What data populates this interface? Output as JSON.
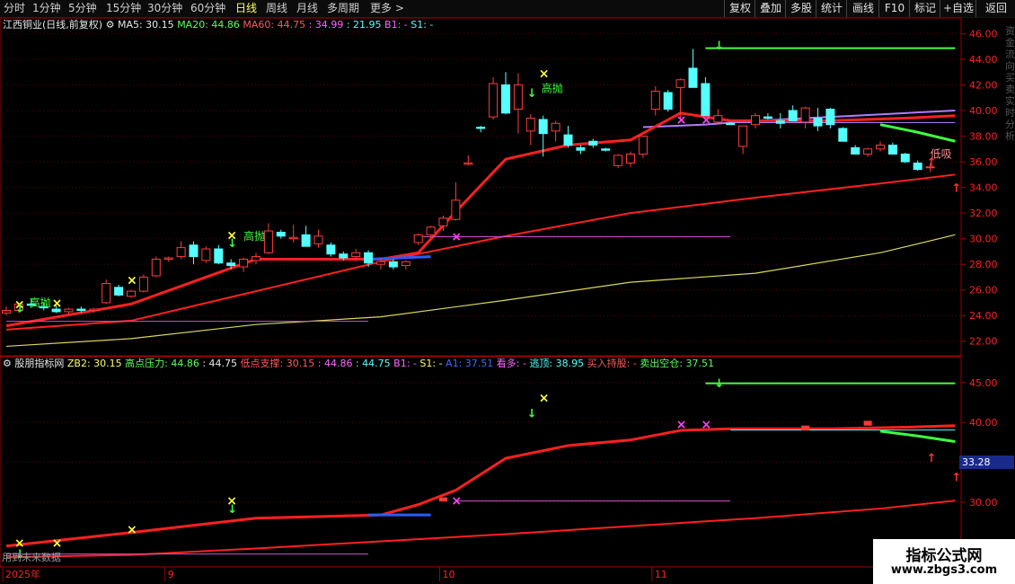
{
  "toolbar": {
    "tabs": [
      "分时",
      "1分钟",
      "5分钟",
      "15分钟",
      "30分钟",
      "60分钟",
      "日线",
      "周线",
      "月线",
      "多周期",
      "更多 >"
    ],
    "active_tab": "日线",
    "buttons": [
      "复权",
      "叠加",
      "多股",
      "统计",
      "画线",
      "F10",
      "标记",
      "+自选",
      "返回"
    ]
  },
  "main_panel": {
    "stock_title": "江西铜业(日线,前复权)",
    "ma5_label": "MA5: 30.15",
    "ma20_label": "MA20: 44.86",
    "ma60_label": "MA60: 44.75",
    "extra_1": ": 34.99",
    "extra_2": ": 21.95",
    "b1_label": "B1: -",
    "s1_label": "S1: -"
  },
  "sub_panel": {
    "indicator_name": "股朋指标网",
    "zb2": "ZB2: 30.15",
    "high_pressure": "高点压力: 44.86",
    "v1": ": 44.75",
    "low_support": "低点支撑: 30.15",
    "v2": ": 44.86",
    "v3": ": 44.75",
    "b1": "B1: -",
    "s1": "S1: -",
    "a1": "A1: 37.51",
    "look_long": "看多: -",
    "escape_top": "逃顶: 38.95",
    "buy_hold": "买入持股: -",
    "sell_empty": "卖出空仓: 37.51",
    "value_badge": "33.28",
    "future_data_note": "用到未来数据"
  },
  "annotations": {
    "high_throw": "高抛",
    "low_buy": "低吸"
  },
  "right_side_text": "资金流向 买卖 实时 分析",
  "watermark": {
    "line1": "指标公式网",
    "line2": "www.zbgs3.com"
  },
  "colors": {
    "up": "#ff3b3b",
    "down": "#54ffff",
    "ma_red": "#ff2020",
    "ma_yellow": "#d8d85a",
    "ma_purple": "#b07cff",
    "resist_green": "#40ff40",
    "support_magenta": "#d050d0",
    "blue_seg": "#2a5cff",
    "axis": "#a00000"
  },
  "chart_data": [
    {
      "type": "candlestick",
      "name": "江西铜业 daily (前复权)",
      "y_ticks": [
        22.0,
        24.0,
        26.0,
        28.0,
        30.0,
        32.0,
        34.0,
        36.0,
        38.0,
        40.0,
        42.0,
        44.0,
        46.0
      ],
      "ylim": [
        21.0,
        46.8
      ],
      "x_labels": [
        "2025年",
        "9",
        "10",
        "11"
      ],
      "x_label_index": [
        0,
        13,
        35,
        52
      ],
      "ohlc": [
        [
          24.2,
          24.7,
          24.0,
          24.4
        ],
        [
          24.4,
          25.0,
          24.2,
          24.9
        ],
        [
          24.9,
          25.3,
          24.6,
          24.8
        ],
        [
          24.7,
          25.0,
          24.4,
          24.6
        ],
        [
          24.5,
          24.8,
          24.2,
          24.3
        ],
        [
          24.3,
          24.6,
          24.1,
          24.5
        ],
        [
          24.5,
          24.7,
          24.2,
          24.4
        ],
        [
          24.4,
          24.6,
          24.2,
          24.5
        ],
        [
          25.0,
          26.8,
          24.9,
          26.5
        ],
        [
          26.2,
          26.4,
          25.5,
          25.6
        ],
        [
          25.5,
          26.0,
          25.4,
          25.9
        ],
        [
          25.9,
          27.2,
          25.8,
          27.0
        ],
        [
          27.1,
          28.6,
          27.0,
          28.4
        ],
        [
          28.4,
          28.6,
          28.2,
          28.5
        ],
        [
          28.6,
          29.8,
          28.4,
          29.3
        ],
        [
          29.5,
          29.8,
          28.0,
          28.6
        ],
        [
          28.3,
          29.4,
          28.1,
          29.2
        ],
        [
          29.2,
          29.5,
          28.0,
          28.1
        ],
        [
          28.1,
          28.4,
          27.6,
          27.9
        ],
        [
          27.8,
          28.5,
          27.4,
          28.4
        ],
        [
          28.3,
          28.9,
          28.0,
          28.6
        ],
        [
          28.9,
          31.2,
          28.8,
          30.6
        ],
        [
          30.5,
          30.7,
          30.0,
          30.2
        ],
        [
          30.0,
          31.1,
          29.7,
          30.1
        ],
        [
          30.3,
          31.0,
          29.6,
          29.4
        ],
        [
          29.6,
          30.7,
          29.3,
          30.2
        ],
        [
          29.5,
          29.7,
          28.6,
          28.8
        ],
        [
          28.8,
          29.0,
          28.3,
          28.5
        ],
        [
          28.6,
          29.2,
          28.3,
          28.9
        ],
        [
          28.9,
          29.1,
          27.8,
          28.1
        ],
        [
          28.0,
          28.5,
          27.6,
          28.2
        ],
        [
          28.2,
          28.4,
          27.6,
          27.8
        ],
        [
          27.9,
          28.3,
          27.6,
          28.2
        ],
        [
          29.7,
          30.4,
          29.5,
          30.3
        ],
        [
          30.3,
          31.0,
          30.1,
          30.9
        ],
        [
          31.0,
          31.8,
          30.6,
          31.6
        ],
        [
          31.5,
          34.4,
          31.4,
          33.0
        ],
        [
          35.8,
          36.5,
          35.7,
          35.9
        ],
        [
          38.7,
          38.8,
          38.3,
          38.6
        ],
        [
          39.5,
          42.6,
          39.3,
          42.1
        ],
        [
          42.0,
          43.0,
          39.7,
          39.8
        ],
        [
          40.1,
          42.9,
          38.2,
          42.0
        ],
        [
          38.4,
          39.7,
          37.3,
          39.4
        ],
        [
          39.3,
          39.6,
          36.4,
          38.2
        ],
        [
          38.4,
          39.2,
          37.6,
          39.0
        ],
        [
          38.1,
          38.8,
          37.1,
          37.3
        ],
        [
          37.1,
          37.3,
          36.6,
          36.9
        ],
        [
          37.6,
          37.8,
          37.1,
          37.3
        ],
        [
          37.0,
          37.1,
          36.8,
          36.9
        ],
        [
          35.7,
          36.6,
          35.5,
          36.5
        ],
        [
          35.9,
          36.8,
          35.6,
          36.6
        ],
        [
          36.6,
          38.0,
          36.3,
          38.0
        ],
        [
          40.1,
          41.9,
          39.6,
          41.5
        ],
        [
          41.4,
          41.6,
          39.9,
          40.1
        ],
        [
          41.8,
          42.5,
          39.2,
          42.4
        ],
        [
          43.3,
          44.8,
          42.0,
          41.8
        ],
        [
          42.1,
          42.6,
          39.7,
          39.6
        ],
        [
          39.1,
          40.1,
          39.0,
          39.6
        ],
        [
          39.0,
          39.1,
          38.9,
          38.9
        ],
        [
          37.2,
          37.4,
          36.6,
          38.8
        ],
        [
          38.9,
          39.8,
          38.6,
          39.6
        ],
        [
          39.5,
          39.8,
          39.3,
          39.4
        ],
        [
          39.2,
          39.8,
          38.6,
          39.0
        ],
        [
          40.0,
          40.4,
          39.5,
          39.2
        ],
        [
          39.1,
          40.3,
          38.6,
          40.2
        ],
        [
          39.4,
          40.2,
          38.4,
          38.8
        ],
        [
          40.1,
          40.2,
          38.6,
          38.9
        ],
        [
          38.6,
          38.7,
          37.6,
          37.6
        ],
        [
          37.1,
          37.3,
          36.6,
          36.6
        ],
        [
          36.6,
          37.1,
          36.4,
          37.0
        ],
        [
          37.0,
          37.6,
          36.8,
          37.3
        ],
        [
          37.3,
          37.5,
          36.6,
          36.6
        ],
        [
          36.6,
          36.7,
          35.9,
          36.0
        ],
        [
          35.9,
          36.1,
          35.3,
          35.4
        ],
        [
          35.6,
          35.9,
          35.2,
          35.6
        ]
      ],
      "series": [
        {
          "name": "MA20 (red)",
          "x": [
            0,
            10,
            20,
            30,
            33,
            36,
            40,
            45,
            50,
            54,
            58,
            62,
            66,
            72,
            76
          ],
          "y": [
            23.2,
            24.9,
            28.4,
            28.4,
            28.9,
            32.1,
            36.2,
            37.3,
            37.7,
            39.8,
            39.2,
            39.2,
            39.2,
            39.4,
            39.6
          ]
        },
        {
          "name": "MA60 (red, lower)",
          "x": [
            0,
            10,
            20,
            30,
            40,
            50,
            60,
            70,
            76
          ],
          "y": [
            22.9,
            23.6,
            25.9,
            28.2,
            30.2,
            32.0,
            33.2,
            34.3,
            35.0
          ]
        },
        {
          "name": "long MA (yellow)",
          "x": [
            0,
            10,
            20,
            30,
            40,
            50,
            60,
            70,
            76
          ],
          "y": [
            21.6,
            22.2,
            23.3,
            23.9,
            25.2,
            26.6,
            27.3,
            28.9,
            30.3
          ]
        },
        {
          "name": "purple MA",
          "x": [
            51,
            56,
            60,
            64,
            68,
            72,
            76
          ],
          "y": [
            38.7,
            38.9,
            39.2,
            39.4,
            39.6,
            39.8,
            40.0
          ]
        }
      ],
      "levels": [
        {
          "name": "高点压力",
          "value": 44.86,
          "from_index": 56,
          "to_index": 76,
          "color": "green"
        },
        {
          "name": "低点支撑",
          "value": 30.15,
          "from_index": 33,
          "to_index": 58,
          "color": "magenta"
        },
        {
          "name": "支撑(早)",
          "value": 23.55,
          "from_index": 0,
          "to_index": 29,
          "color": "magenta"
        },
        {
          "name": "参考线",
          "value": 39.05,
          "from_index": 58,
          "to_index": 76,
          "color": "purple"
        }
      ]
    },
    {
      "type": "line",
      "name": "股朋指标网 sub-indicator",
      "y_ticks": [
        30.0,
        35.0,
        40.0,
        45.0
      ],
      "ylim": [
        22.0,
        47.0
      ],
      "series": [
        {
          "name": "ZB red",
          "x": [
            0,
            10,
            20,
            30,
            33,
            36,
            40,
            45,
            50,
            54,
            58,
            62,
            66,
            72,
            76
          ],
          "y": [
            24.5,
            26.2,
            28.0,
            28.4,
            29.7,
            31.5,
            35.5,
            37.1,
            37.8,
            39.0,
            39.2,
            39.2,
            39.2,
            39.4,
            39.6
          ]
        },
        {
          "name": "lower red",
          "x": [
            0,
            10,
            20,
            30,
            40,
            50,
            60,
            70,
            76
          ],
          "y": [
            23.1,
            23.4,
            24.2,
            25.1,
            26.0,
            27.0,
            28.0,
            29.2,
            30.2
          ]
        }
      ]
    }
  ]
}
